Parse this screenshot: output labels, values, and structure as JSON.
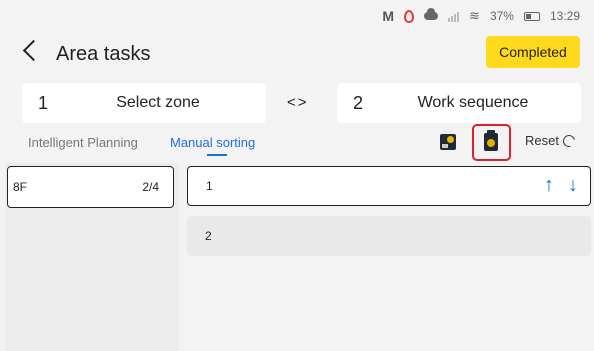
{
  "status_bar": {
    "battery": "37%",
    "time": "13:29"
  },
  "header": {
    "title": "Area tasks",
    "status": "Completed"
  },
  "steps": [
    {
      "number": "1",
      "label": "Select zone"
    },
    {
      "number": "2",
      "label": "Work sequence"
    }
  ],
  "swap_glyph": "<>",
  "tabs": [
    {
      "label": "Intelligent Planning",
      "active": false
    },
    {
      "label": "Manual sorting",
      "active": true
    }
  ],
  "toolbar": {
    "reset_label": "Reset"
  },
  "floors": [
    {
      "name": "8F",
      "count": "2/4"
    }
  ],
  "sequence": [
    {
      "label": "1"
    },
    {
      "label": "2"
    }
  ],
  "icons": {
    "back": "chevron-left-icon",
    "tool_1": "image-icon",
    "tool_2": "clipboard-icon",
    "reset": "refresh-icon",
    "up": "arrow-up-icon",
    "down": "arrow-down-icon"
  },
  "colors": {
    "accent": "#1e6fd9",
    "badge": "#ffd91c",
    "highlight": "#e0202a"
  }
}
